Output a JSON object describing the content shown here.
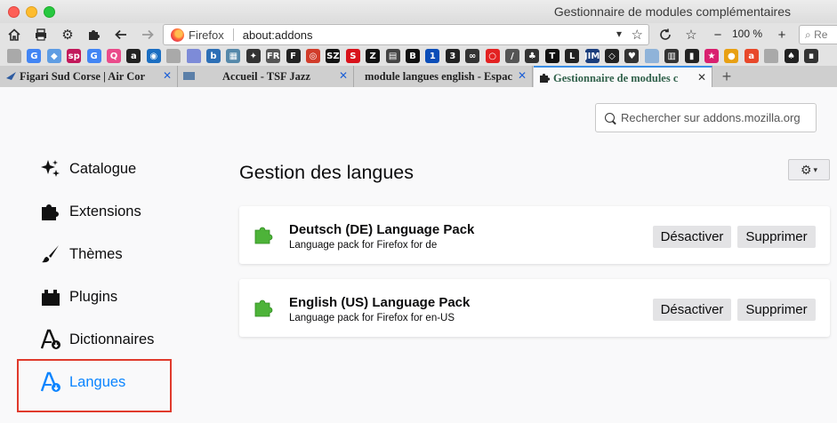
{
  "window": {
    "title": "Gestionnaire de modules complémentaires"
  },
  "urlbar": {
    "identity": "Firefox",
    "url": "about:addons",
    "zoom": "100 %",
    "search_placeholder": "Re"
  },
  "bookmarks": [
    {
      "icon": "folder-icon",
      "label": "",
      "color": "#a9a9a9"
    },
    {
      "icon": "google-icon",
      "label": "G",
      "color": "#4285f4"
    },
    {
      "icon": "bookmark-icon",
      "label": "◆",
      "color": "#5f9de3"
    },
    {
      "icon": "sp-icon",
      "label": "sp",
      "color": "#c2185b"
    },
    {
      "icon": "google-icon",
      "label": "G",
      "color": "#4285f4"
    },
    {
      "icon": "qwant-icon",
      "label": "Q",
      "color": "#ea4b8b"
    },
    {
      "icon": "amazon-icon",
      "label": "a",
      "color": "#222222"
    },
    {
      "icon": "site-icon",
      "label": "◉",
      "color": "#1b6ec2"
    },
    {
      "icon": "folder-icon",
      "label": "",
      "color": "#a9a9a9"
    },
    {
      "icon": "folder-icon",
      "label": "",
      "color": "#7d8bd8"
    },
    {
      "icon": "site-icon",
      "label": "b",
      "color": "#2d6fb6"
    },
    {
      "icon": "site-icon",
      "label": "▦",
      "color": "#5588aa"
    },
    {
      "icon": "site-icon",
      "label": "✦",
      "color": "#333333"
    },
    {
      "icon": "fr-icon",
      "label": "FR",
      "color": "#555555"
    },
    {
      "icon": "fnp-icon",
      "label": "F",
      "color": "#222222"
    },
    {
      "icon": "site-icon",
      "label": "◎",
      "color": "#d13c2a"
    },
    {
      "icon": "sz-icon",
      "label": "SZ",
      "color": "#111111"
    },
    {
      "icon": "spiegel-icon",
      "label": "S",
      "color": "#d8121b"
    },
    {
      "icon": "z-icon",
      "label": "Z",
      "color": "#111111"
    },
    {
      "icon": "site-icon",
      "label": "▤",
      "color": "#444444"
    },
    {
      "icon": "bbc-icon",
      "label": "B",
      "color": "#111111"
    },
    {
      "icon": "site-icon",
      "label": "1",
      "color": "#0b4db8"
    },
    {
      "icon": "site-icon",
      "label": "3",
      "color": "#222222"
    },
    {
      "icon": "site-icon",
      "label": "∞",
      "color": "#333333"
    },
    {
      "icon": "site-icon",
      "label": "○",
      "color": "#e32222"
    },
    {
      "icon": "site-icon",
      "label": "/",
      "color": "#555555"
    },
    {
      "icon": "site-icon",
      "label": "♣",
      "color": "#333333"
    },
    {
      "icon": "nyt-icon",
      "label": "T",
      "color": "#111111"
    },
    {
      "icon": "site-icon",
      "label": "L",
      "color": "#222222"
    },
    {
      "icon": "jim-icon",
      "label": "JIM",
      "color": "#1a3d7c"
    },
    {
      "icon": "site-icon",
      "label": "◇",
      "color": "#222222"
    },
    {
      "icon": "site-icon",
      "label": "♥",
      "color": "#333333"
    },
    {
      "icon": "folder-icon",
      "label": "",
      "color": "#8fb3d9"
    },
    {
      "icon": "site-icon",
      "label": "▥",
      "color": "#333333"
    },
    {
      "icon": "site-icon",
      "label": "▮",
      "color": "#222222"
    },
    {
      "icon": "site-icon",
      "label": "★",
      "color": "#d9206f"
    },
    {
      "icon": "site-icon",
      "label": "●",
      "color": "#e8a013"
    },
    {
      "icon": "site-icon",
      "label": "a",
      "color": "#e8482a"
    },
    {
      "icon": "folder-icon",
      "label": "",
      "color": "#a9a9a9"
    },
    {
      "icon": "site-icon",
      "label": "♠",
      "color": "#222222"
    },
    {
      "icon": "site-icon",
      "label": "∎",
      "color": "#333333"
    }
  ],
  "tabs": [
    {
      "label": "Figari Sud Corse | Air Cor",
      "active": false
    },
    {
      "label": "Accueil - TSF Jazz",
      "active": false
    },
    {
      "label": "module langues english - Espac",
      "active": false
    },
    {
      "label": "Gestionnaire de modules c",
      "active": true
    }
  ],
  "content": {
    "search_placeholder": "Rechercher sur addons.mozilla.org",
    "title": "Gestion des langues",
    "categories": [
      {
        "label": "Catalogue",
        "icon": "sparkle-icon",
        "selected": false
      },
      {
        "label": "Extensions",
        "icon": "puzzle-icon",
        "selected": false
      },
      {
        "label": "Thèmes",
        "icon": "brush-icon",
        "selected": false
      },
      {
        "label": "Plugins",
        "icon": "plugin-icon",
        "selected": false
      },
      {
        "label": "Dictionnaires",
        "icon": "dictionary-icon",
        "selected": false
      },
      {
        "label": "Langues",
        "icon": "language-icon",
        "selected": true
      }
    ],
    "addons": [
      {
        "name": "Deutsch (DE) Language Pack",
        "description": "Language pack for Firefox for de",
        "disable_label": "Désactiver",
        "remove_label": "Supprimer"
      },
      {
        "name": "English (US) Language Pack",
        "description": "Language pack for Firefox for en-US",
        "disable_label": "Désactiver",
        "remove_label": "Supprimer"
      }
    ]
  },
  "colors": {
    "accent": "#0a84ff",
    "highlight": "#e03a2c",
    "addon_green": "#4db339"
  }
}
